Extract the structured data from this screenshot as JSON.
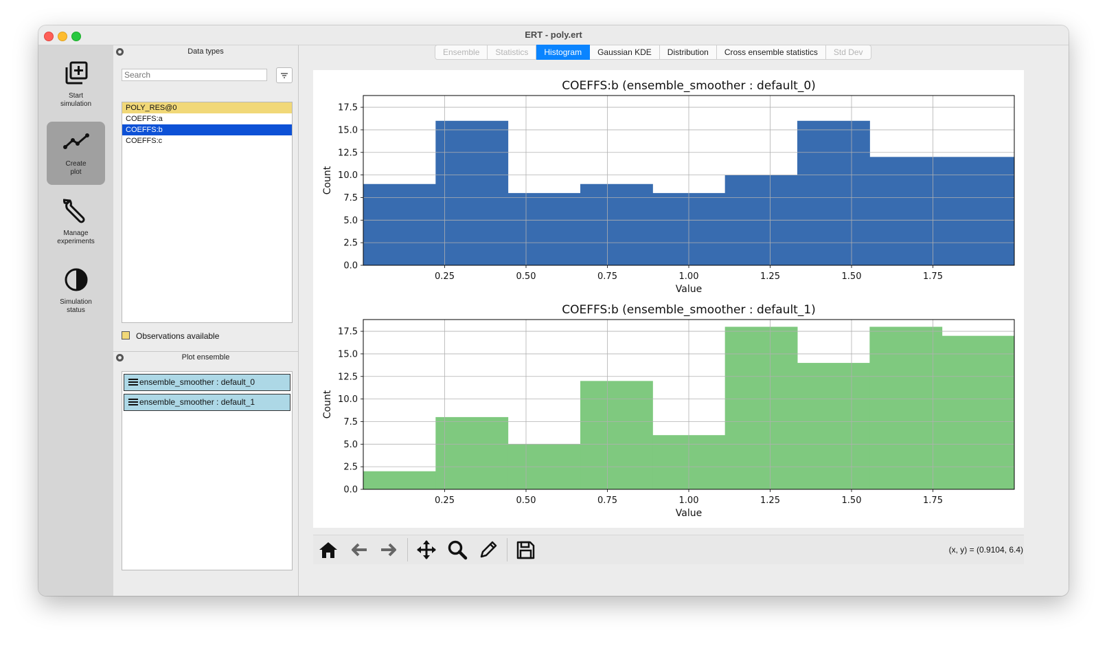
{
  "window": {
    "title": "ERT - poly.ert"
  },
  "sidebar": {
    "items": [
      {
        "label": "Start\nsimulation",
        "icon": "add-box-icon",
        "active": false
      },
      {
        "label": "Create\nplot",
        "icon": "line-chart-icon",
        "active": true
      },
      {
        "label": "Manage\nexperiments",
        "icon": "wrench-icon",
        "active": false
      },
      {
        "label": "Simulation\nstatus",
        "icon": "half-circle-icon",
        "active": false
      }
    ]
  },
  "data_types": {
    "title": "Data types",
    "search_placeholder": "Search",
    "items": [
      "POLY_RES@0",
      "COEFFS:a",
      "COEFFS:b",
      "COEFFS:c"
    ],
    "observation_item": "POLY_RES@0",
    "selected": "COEFFS:b",
    "observations_label": "Observations available",
    "observation_color": "#f1d878",
    "selection_color": "#0d51d6"
  },
  "plot_ensemble": {
    "title": "Plot ensemble",
    "items": [
      "ensemble_smoother : default_0",
      "ensemble_smoother : default_1"
    ]
  },
  "tabs": [
    {
      "label": "Ensemble",
      "state": "disabled"
    },
    {
      "label": "Statistics",
      "state": "disabled"
    },
    {
      "label": "Histogram",
      "state": "active"
    },
    {
      "label": "Gaussian KDE",
      "state": "normal"
    },
    {
      "label": "Distribution",
      "state": "normal"
    },
    {
      "label": "Cross ensemble statistics",
      "state": "normal"
    },
    {
      "label": "Std Dev",
      "state": "disabled"
    }
  ],
  "toolbar": {
    "buttons": [
      "home-icon",
      "back-arrow-icon",
      "forward-arrow-icon",
      "pan-icon",
      "zoom-icon",
      "edit-icon",
      "save-icon"
    ],
    "coordinates": "(x, y) = (0.9104, 6.4)"
  },
  "chart_data": [
    {
      "type": "bar",
      "title": "COEFFS:b (ensemble_smoother : default_0)",
      "xlabel": "Value",
      "ylabel": "Count",
      "color": "#386cb0",
      "bin_edges": [
        0.0,
        0.2222,
        0.4444,
        0.6667,
        0.8889,
        1.1111,
        1.3333,
        1.5556,
        1.7778,
        2.0
      ],
      "values": [
        9,
        16,
        8,
        9,
        8,
        10,
        16,
        12,
        12
      ],
      "xlim": [
        0.0,
        2.0
      ],
      "ylim": [
        0,
        18.8
      ],
      "xticks": [
        "0.25",
        "0.50",
        "0.75",
        "1.00",
        "1.25",
        "1.50",
        "1.75"
      ],
      "yticks": [
        "0.0",
        "2.5",
        "5.0",
        "7.5",
        "10.0",
        "12.5",
        "15.0",
        "17.5"
      ],
      "grid": true
    },
    {
      "type": "bar",
      "title": "COEFFS:b (ensemble_smoother : default_1)",
      "xlabel": "Value",
      "ylabel": "Count",
      "color": "#7fc97f",
      "bin_edges": [
        0.0,
        0.2222,
        0.4444,
        0.6667,
        0.8889,
        1.1111,
        1.3333,
        1.5556,
        1.7778,
        2.0
      ],
      "values": [
        2,
        8,
        5,
        12,
        6,
        18,
        14,
        18,
        17
      ],
      "xlim": [
        0.0,
        2.0
      ],
      "ylim": [
        0,
        18.8
      ],
      "xticks": [
        "0.25",
        "0.50",
        "0.75",
        "1.00",
        "1.25",
        "1.50",
        "1.75"
      ],
      "yticks": [
        "0.0",
        "2.5",
        "5.0",
        "7.5",
        "10.0",
        "12.5",
        "15.0",
        "17.5"
      ],
      "grid": true
    }
  ]
}
